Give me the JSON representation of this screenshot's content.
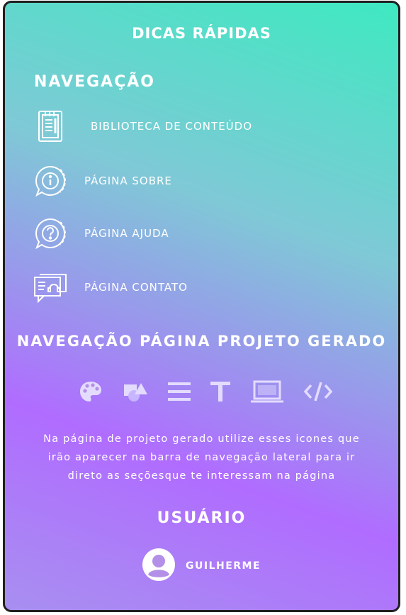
{
  "header": {
    "title": "DICAS RÁPIDAS"
  },
  "navigation": {
    "title": "NAVEGAÇÃO",
    "items": [
      {
        "label": "BIBLIOTECA DE CONTEÚDO",
        "icon": "document-icon"
      },
      {
        "label": "PÁGINA SOBRE",
        "icon": "info-chat-icon"
      },
      {
        "label": "PÁGINA AJUDA",
        "icon": "help-chat-icon"
      },
      {
        "label": "PÁGINA CONTATO",
        "icon": "contact-chat-icon"
      }
    ]
  },
  "project_nav": {
    "title": "NAVEGAÇÃO PÁGINA PROJETO GERADO",
    "icons": [
      "palette-icon",
      "shapes-icon",
      "lines-icon",
      "text-icon",
      "laptop-icon",
      "code-icon"
    ],
    "description": "Na página de projeto gerado utilize esses icones que irão aparecer na barra de navegação lateral para ir direto as seçõesque te interessam na página"
  },
  "user": {
    "title": "USUÁRIO",
    "name": "GUILHERME"
  },
  "colors": {
    "gradient_top": "#3ee9c1",
    "gradient_bottom": "#b06cff",
    "text": "#ffffff",
    "icon_muted": "#e4dcff"
  }
}
